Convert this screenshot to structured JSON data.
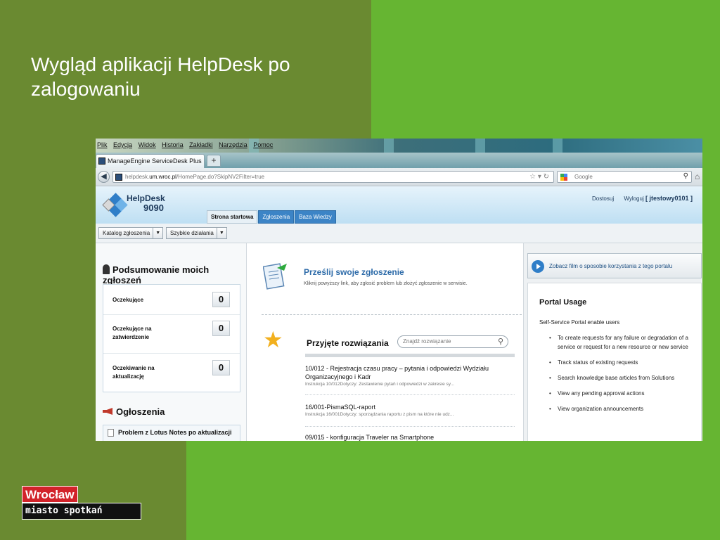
{
  "slide": {
    "title": "Wygląd aplikacji HelpDesk po zalogowaniu"
  },
  "browser": {
    "menus": [
      "Plik",
      "Edycja",
      "Widok",
      "Historia",
      "Zakładki",
      "Narzędzia",
      "Pomoc"
    ],
    "tab_title": "ManageEngine ServiceDesk Plus",
    "new_tab": "+",
    "url_prefix": "helpdesk.",
    "url_domain": "um.wroc.pl",
    "url_path": "/HomePage.do?SkipNV2Filter=true",
    "search_placeholder": "Google"
  },
  "app": {
    "logo_name": "HelpDesk",
    "logo_number": "9090",
    "links": {
      "customize": "Dostosuj",
      "logout": "Wyloguj",
      "user": "[ jtestowy0101 ]"
    },
    "tabs": [
      {
        "label": "Strona startowa",
        "active": true
      },
      {
        "label": "Zgłoszenia",
        "active": false
      },
      {
        "label": "Baza Wiedzy",
        "active": false
      }
    ],
    "toolbar": {
      "catalog": "Katalog zgłoszenia",
      "quick": "Szybkie działania"
    }
  },
  "summary": {
    "title": "Podsumowanie moich zgłoszeń",
    "rows": [
      {
        "label": "Oczekujące",
        "count": "0"
      },
      {
        "label": "Oczekujące na zatwierdzenie",
        "count": "0"
      },
      {
        "label": "Oczekiwanie na aktualizację",
        "count": "0"
      }
    ]
  },
  "announcements": {
    "title": "Ogłoszenia",
    "items": [
      "Problem z Lotus Notes po aktualizacji"
    ]
  },
  "submit": {
    "title": "Prześlij swoje zgłoszenie",
    "description": "Kliknij powyższy link, aby zgłosić problem lub złożyć zgłoszenie w serwisie."
  },
  "solutions": {
    "title": "Przyjęte rozwiązania",
    "search_placeholder": "Znajdź rozwiązanie",
    "items": [
      {
        "title": "10/012 - Rejestracja czasu pracy – pytania i odpowiedzi Wydziału Organizacyjnego i Kadr",
        "desc": "Instrukcja 10/012Dotyczy: Zestawienie pytań i odpowiedzi w zakresie sy..."
      },
      {
        "title": "16/001-PismaSQL-raport",
        "desc": "Instrukcja 16/001Dotyczy: sporządzania raportu z pism na które nie udz..."
      },
      {
        "title": "09/015 - konfiguracja Traveler na Smartphone",
        "desc": ""
      }
    ]
  },
  "right_panel": {
    "video_link": "Zobacz film o sposobie korzystania z tego portalu",
    "portal_title": "Portal Usage",
    "portal_intro": "Self-Service Portal enable users",
    "portal_points": [
      "To create requests for any failure or degradation of a service or request for a new resource or new service",
      "Track status of existing requests",
      "Search knowledge base articles from Solutions",
      "View any pending approval actions",
      "View organization announcements"
    ]
  },
  "branding": {
    "top": "Wrocław",
    "bottom": "miasto spotkań"
  }
}
